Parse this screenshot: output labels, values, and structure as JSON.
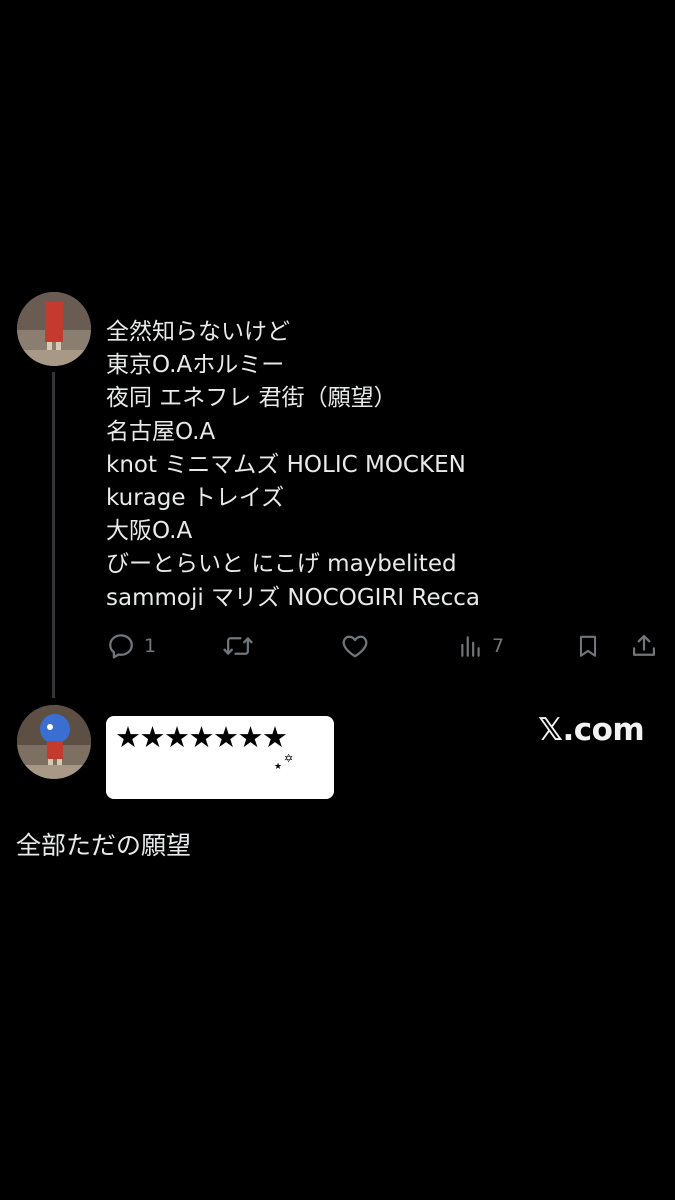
{
  "tweet": {
    "lines": [
      "全然知らないけど",
      "東京O.Aホルミー",
      "夜同 エネフレ 君街（願望）",
      "名古屋O.A",
      "knot ミニマムズ HOLIC MOCKEN",
      "kurage トレイズ",
      "大阪O.A",
      "びーとらいと にこげ maybelited",
      "sammoji マリズ NOCOGIRI  Recca"
    ],
    "actions": {
      "reply_count": "1",
      "retweet_count": "",
      "like_count": "",
      "views_count": "7"
    }
  },
  "reply": {
    "name_redacted": "★★★★★★★",
    "tiny_star": "★",
    "tiny_star2": "✡"
  },
  "watermark": "𝕏.com",
  "caption": "全部ただの願望",
  "icons": {
    "reply": "reply-icon",
    "retweet": "retweet-icon",
    "like": "heart-icon",
    "views": "views-icon",
    "bookmark": "bookmark-icon",
    "share": "share-icon"
  },
  "colors": {
    "background": "#000000",
    "text": "#e7e9ea",
    "muted": "#71767b",
    "thread_line": "#333639"
  }
}
